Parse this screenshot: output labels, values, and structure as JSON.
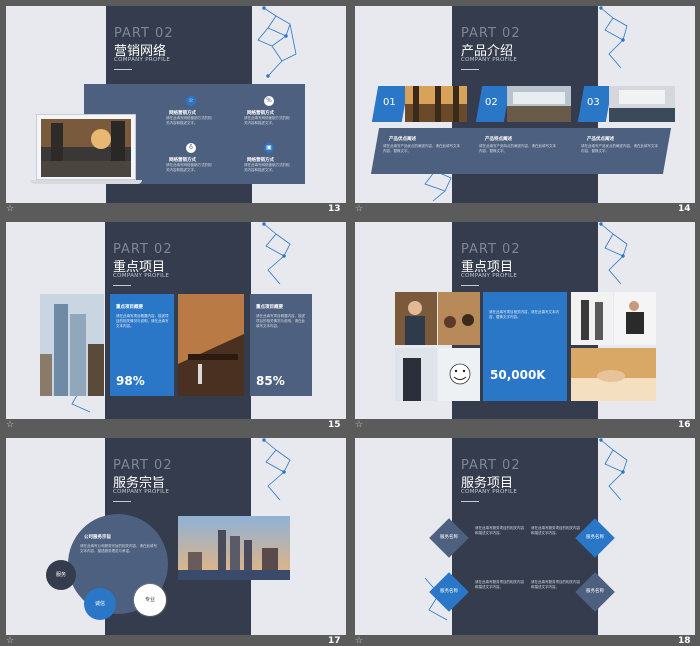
{
  "common": {
    "part": "PART 02",
    "company": "COMPANY PROFILE",
    "star_glyph": "☆"
  },
  "slide13": {
    "number": "13",
    "title": "营销网络",
    "items": [
      {
        "title": "网络营销方式",
        "text": "请在此填写网络营销方式的相关内容和描述文字。"
      },
      {
        "title": "网络营销方式",
        "text": "请在此填写网络营销方式的相关内容和描述文字。"
      },
      {
        "title": "网络营销方式",
        "text": "请在此填写网络营销方式的相关内容和描述文字。"
      },
      {
        "title": "网络营销方式",
        "text": "请在此填写网络营销方式的相关内容和描述文字。"
      }
    ]
  },
  "slide14": {
    "number": "14",
    "title": "产品介绍",
    "tabs": [
      "01",
      "02",
      "03"
    ],
    "cols": [
      {
        "title": "产品优点阐述",
        "text": "请在此填写产品优点的阐述内容，请在此填写文本内容，替换文字。"
      },
      {
        "title": "产品特点阐述",
        "text": "请在此填写产品特点的阐述内容，请在此填写文本内容，替换文字。"
      },
      {
        "title": "产品优点阐述",
        "text": "请在此填写产品优点的阐述内容，请在此填写文本内容，替换文字。"
      }
    ]
  },
  "slide15": {
    "number": "15",
    "title": "重点项目",
    "cards": [
      {
        "title": "重点项目概要",
        "text": "请在此填写项目概要内容，描述项目的相关情况与说明，请在此填写文本内容。",
        "value": "98%"
      },
      {
        "title": "重点项目概要",
        "text": "请在此填写项目概要内容，描述项目的相关情况与说明，请在此填写文本内容。",
        "value": "85%"
      }
    ]
  },
  "slide16": {
    "number": "16",
    "title": "重点项目",
    "text": "请在此填写项目相关内容，请在此填写文本内容，替换文字内容。",
    "value": "50,000K"
  },
  "slide17": {
    "number": "17",
    "title": "服务宗旨",
    "circle_title": "公司服务宗旨",
    "circle_text": "请在此填写公司服务宗旨的相关内容，请在此填写文本内容，描述服务理念与承诺。",
    "labels": [
      "服务",
      "诚信",
      "专业"
    ]
  },
  "slide18": {
    "number": "18",
    "title": "服务项目",
    "items": [
      {
        "label": "服务名称",
        "text": "请在此填写服务项目的相关内容和描述文字内容。"
      },
      {
        "label": "服务名称",
        "text": "请在此填写服务项目的相关内容和描述文字内容。"
      },
      {
        "label": "服务名称",
        "text": "请在此填写服务项目的相关内容和描述文字内容。"
      },
      {
        "label": "服务名称",
        "text": "请在此填写服务项目的相关内容和描述文字内容。"
      }
    ]
  },
  "colors": {
    "dark_panel": "#343c4d",
    "accent_blue": "#2a77c7",
    "slate_box": "#4d607f",
    "slide_bg": "#e7e9ee"
  }
}
